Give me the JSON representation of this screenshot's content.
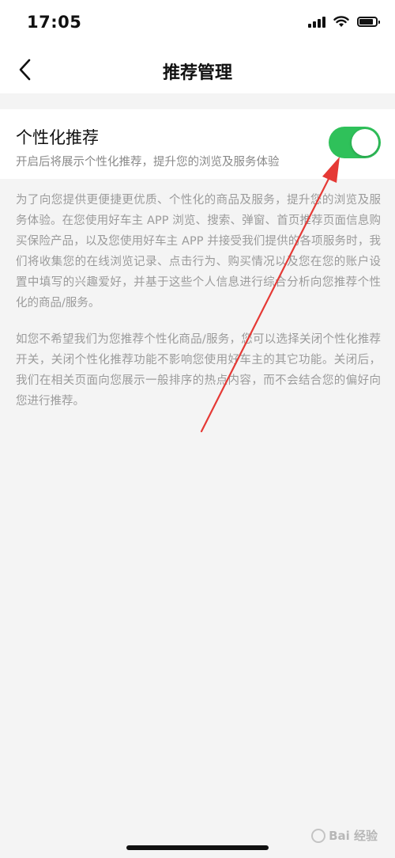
{
  "status_bar": {
    "time": "17:05",
    "icons": [
      "signal-icon",
      "wifi-icon",
      "battery-icon"
    ]
  },
  "nav": {
    "title": "推荐管理",
    "back_icon": "chevron-left-icon"
  },
  "setting": {
    "title": "个性化推荐",
    "description": "开启后将展示个性化推荐，提升您的浏览及服务体验",
    "toggle_on": true,
    "toggle_color": "#2fc15a"
  },
  "info": {
    "paragraph_1": "为了向您提供更便捷更优质、个性化的商品及服务，提升您的浏览及服务体验。在您使用好车主 APP 浏览、搜索、弹窗、首页推荐页面信息购买保险产品，以及您使用好车主 APP 并接受我们提供的各项服务时，我们将收集您的在线浏览记录、点击行为、购买情况以及您在您的账户设置中填写的兴趣爱好，并基于这些个人信息进行综合分析向您推荐个性化的商品/服务。",
    "paragraph_2": "如您不希望我们为您推荐个性化商品/服务，您可以选择关闭个性化推荐开关，关闭个性化推荐功能不影响您使用好车主的其它功能。关闭后，我们在相关页面向您展示一般排序的热点内容，而不会结合您的偏好向您进行推荐。"
  },
  "annotation": {
    "arrow_color": "#e53935"
  },
  "watermark": {
    "text": "Bai 经验"
  }
}
